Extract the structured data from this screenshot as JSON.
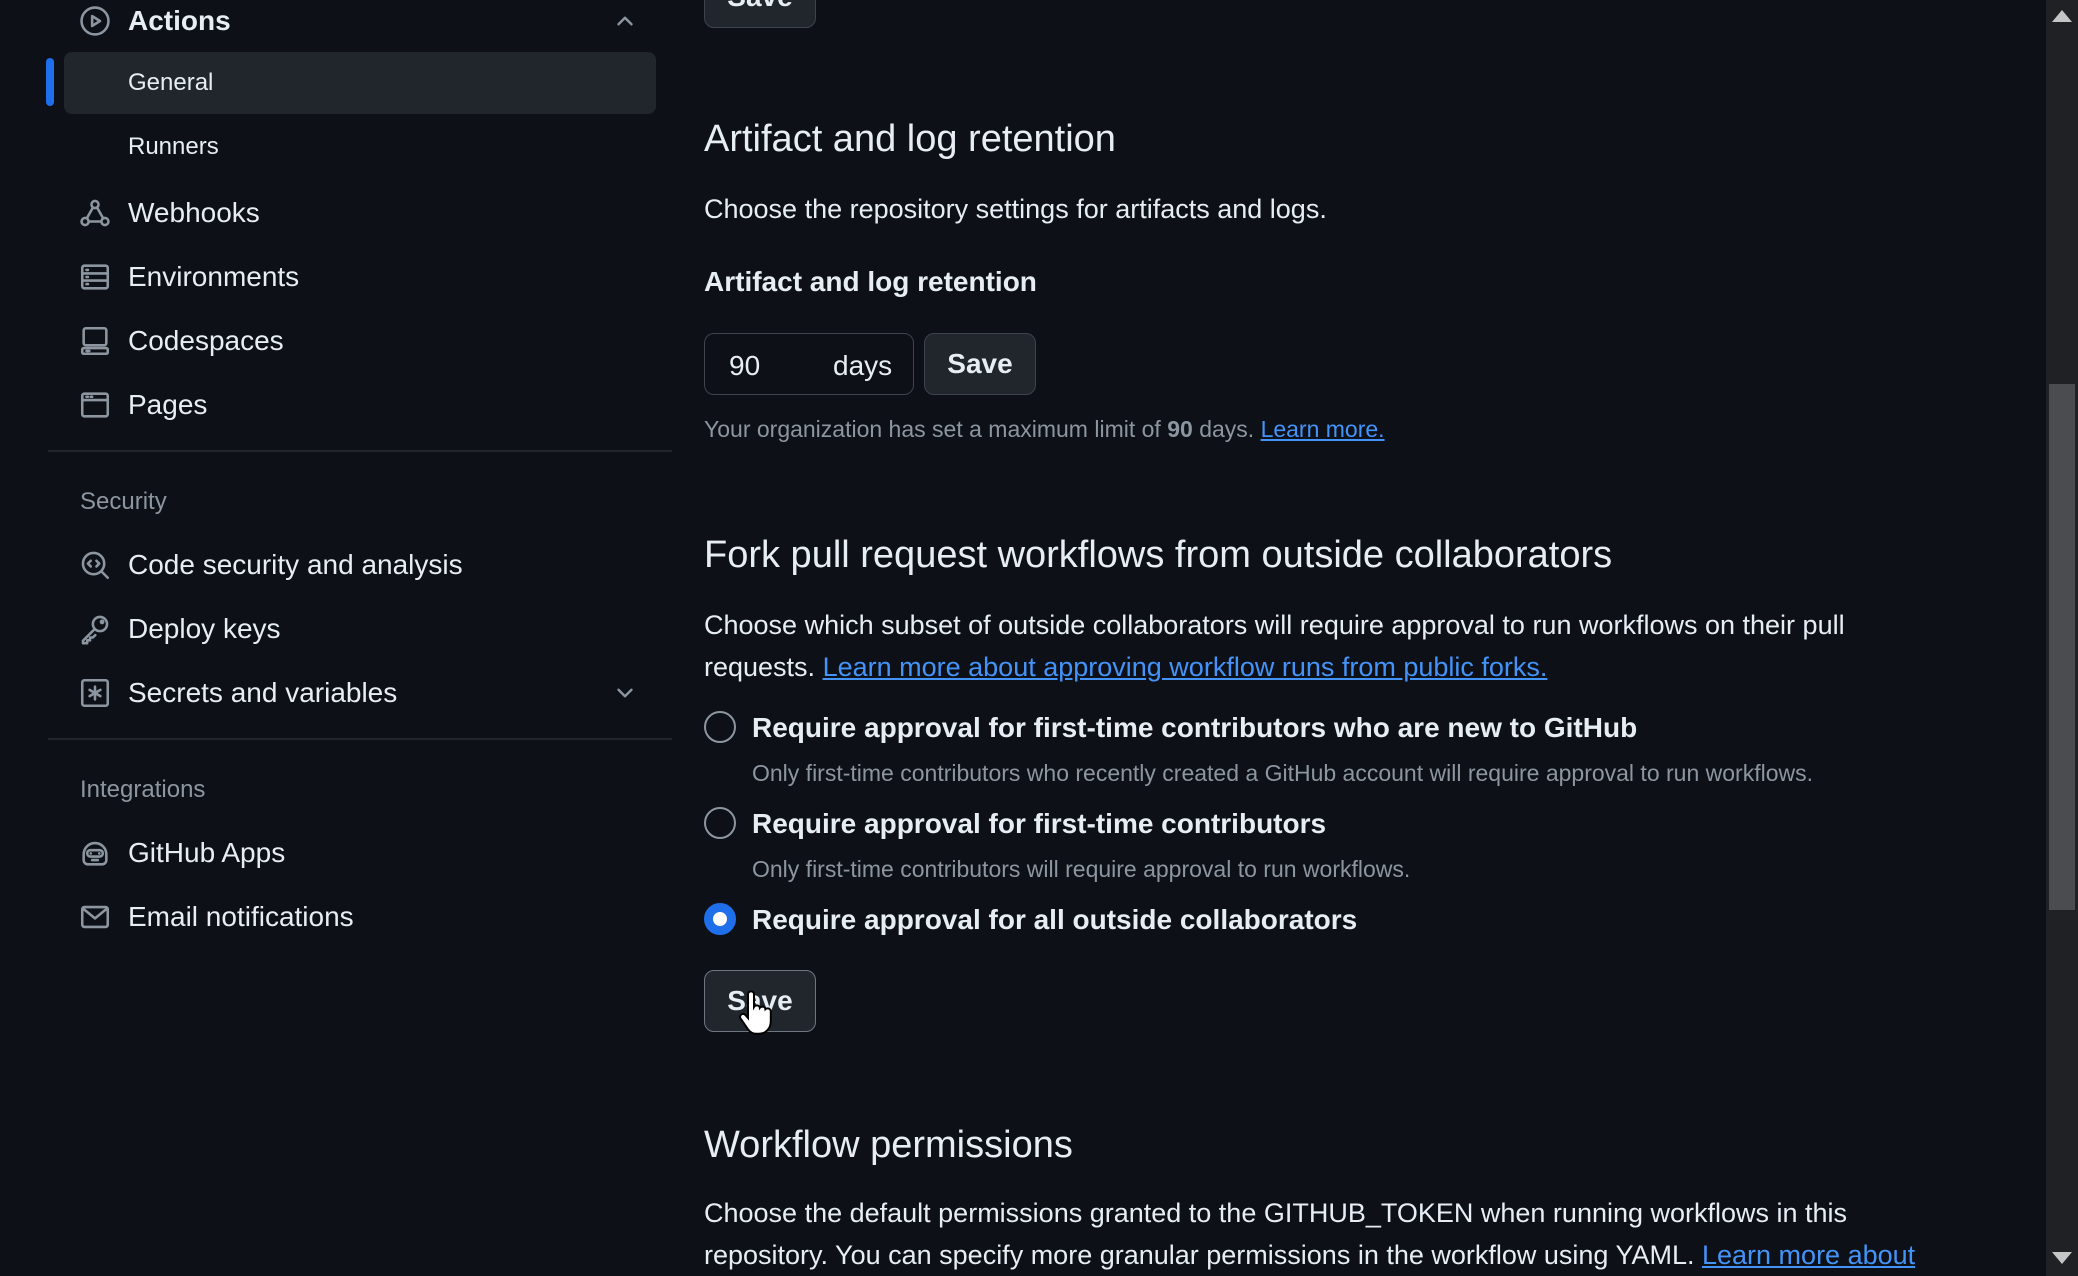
{
  "sidebar": {
    "actions": {
      "label": "Actions",
      "icon": "play-circle-icon",
      "expanded": true
    },
    "actions_sub": [
      {
        "label": "General",
        "selected": true
      },
      {
        "label": "Runners",
        "selected": false
      }
    ],
    "items": [
      {
        "label": "Webhooks",
        "icon": "webhook-icon"
      },
      {
        "label": "Environments",
        "icon": "server-icon"
      },
      {
        "label": "Codespaces",
        "icon": "codespaces-icon"
      },
      {
        "label": "Pages",
        "icon": "browser-icon"
      }
    ],
    "security": {
      "heading": "Security",
      "items": [
        {
          "label": "Code security and analysis",
          "icon": "codescan-icon"
        },
        {
          "label": "Deploy keys",
          "icon": "key-icon"
        },
        {
          "label": "Secrets and variables",
          "icon": "key-asterisk-icon",
          "expandable": true
        }
      ]
    },
    "integrations": {
      "heading": "Integrations",
      "items": [
        {
          "label": "GitHub Apps",
          "icon": "hubot-icon"
        },
        {
          "label": "Email notifications",
          "icon": "mail-icon"
        }
      ]
    }
  },
  "top_save_label": "Save",
  "retention": {
    "title": "Artifact and log retention",
    "description": "Choose the repository settings for artifacts and logs.",
    "field_label": "Artifact and log retention",
    "value": "90",
    "unit": "days",
    "save_label": "Save",
    "note_prefix": "Your organization has set a maximum limit of",
    "note_value": "90",
    "note_suffix": "days.",
    "note_link": "Learn more."
  },
  "fork": {
    "title": "Fork pull request workflows from outside collaborators",
    "description_line1": "Choose which subset of outside collaborators will require approval to run workflows on their pull",
    "description_line2_prefix": "requests.",
    "description_link": "Learn more about approving workflow runs from public forks.",
    "options": [
      {
        "label": "Require approval for first-time contributors who are new to GitHub",
        "description": "Only first-time contributors who recently created a GitHub account will require approval to run workflows.",
        "checked": false
      },
      {
        "label": "Require approval for first-time contributors",
        "description": "Only first-time contributors will require approval to run workflows.",
        "checked": false
      },
      {
        "label": "Require approval for all outside collaborators",
        "description": "",
        "checked": true
      }
    ],
    "save_label": "Save"
  },
  "workflow_permissions": {
    "title": "Workflow permissions",
    "description_line1": "Choose the default permissions granted to the GITHUB_TOKEN when running workflows in this",
    "description_line2": "repository. You can specify more granular permissions in the workflow using YAML.",
    "link": "Learn more about"
  },
  "colors": {
    "background": "#0d1117",
    "accent": "#1f6feb",
    "link": "#4493f8",
    "muted": "#8d96a0"
  }
}
